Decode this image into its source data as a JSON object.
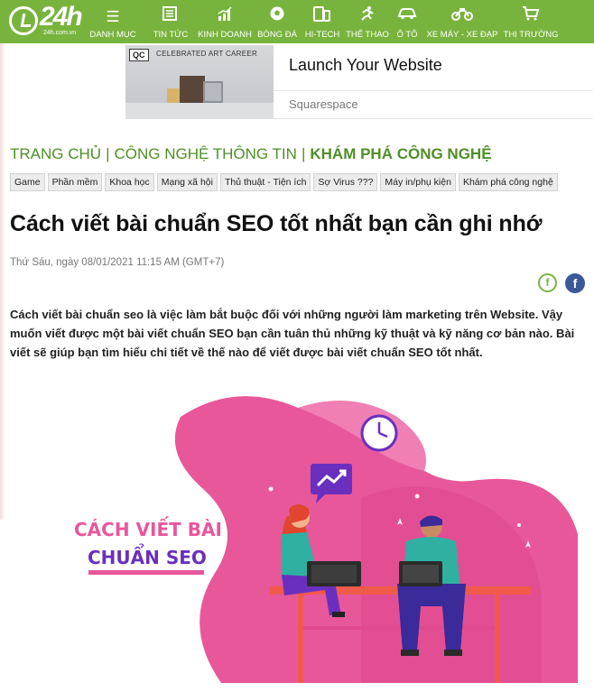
{
  "site": {
    "logo_number": "24h",
    "logo_sub": "24h.com.vn"
  },
  "nav": {
    "menu_label": "DANH MỤC",
    "items": [
      {
        "label": "TIN TỨC",
        "icon": "newspaper-icon"
      },
      {
        "label": "KINH DOANH",
        "icon": "bar-chart-icon"
      },
      {
        "label": "BÓNG ĐÁ",
        "icon": "soccer-ball-icon"
      },
      {
        "label": "HI-TECH",
        "icon": "phone-tablet-icon"
      },
      {
        "label": "THỂ THAO",
        "icon": "runner-icon"
      },
      {
        "label": "Ô TÔ",
        "icon": "car-icon"
      },
      {
        "label": "XE MÁY - XE ĐẠP",
        "icon": "motorbike-icon"
      },
      {
        "label": "THỊ TRƯỜNG",
        "icon": "shopping-cart-icon"
      }
    ]
  },
  "ad": {
    "badge": "QC",
    "image_text": "CELEBRATED ART CAREER",
    "headline": "Launch Your Website",
    "brand": "Squarespace"
  },
  "breadcrumb": {
    "home": "TRANG CHỦ",
    "section": "CÔNG NGHỆ THÔNG TIN",
    "current": "KHÁM PHÁ CÔNG NGHỆ"
  },
  "tags": [
    "Game",
    "Phần mềm",
    "Khoa học",
    "Mạng xã hội",
    "Thủ thuật - Tiện ích",
    "Sợ Virus ???",
    "Máy in/phụ kiện",
    "Khám phá công nghệ"
  ],
  "article": {
    "title": "Cách viết bài chuẩn SEO tốt nhất bạn cần ghi nhớ",
    "date": "Thứ Sáu, ngày 08/01/2021 11:15 AM (GMT+7)",
    "lead": "Cách viết bài chuẩn seo là việc làm bắt buộc đối với những người làm marketing trên Website. Vậy muốn viết được một bài viết chuẩn SEO bạn cần tuân thủ những kỹ thuật và kỹ năng cơ bản nào. Bài viết sẽ giúp bạn tìm hiểu chi tiết về thế nào để viết được bài viết chuẩn SEO tốt nhất."
  },
  "share": {
    "f_label": "f",
    "facebook_label": "f"
  },
  "hero": {
    "line1": "CÁCH VIẾT BÀI",
    "line2": "CHUẨN SEO"
  },
  "colors": {
    "nav_green": "#78b43d",
    "breadcrumb_green": "#4e8f26",
    "hero_pink": "#e8579a",
    "hero_purple": "#6a2fbf",
    "facebook_blue": "#3b5998"
  }
}
